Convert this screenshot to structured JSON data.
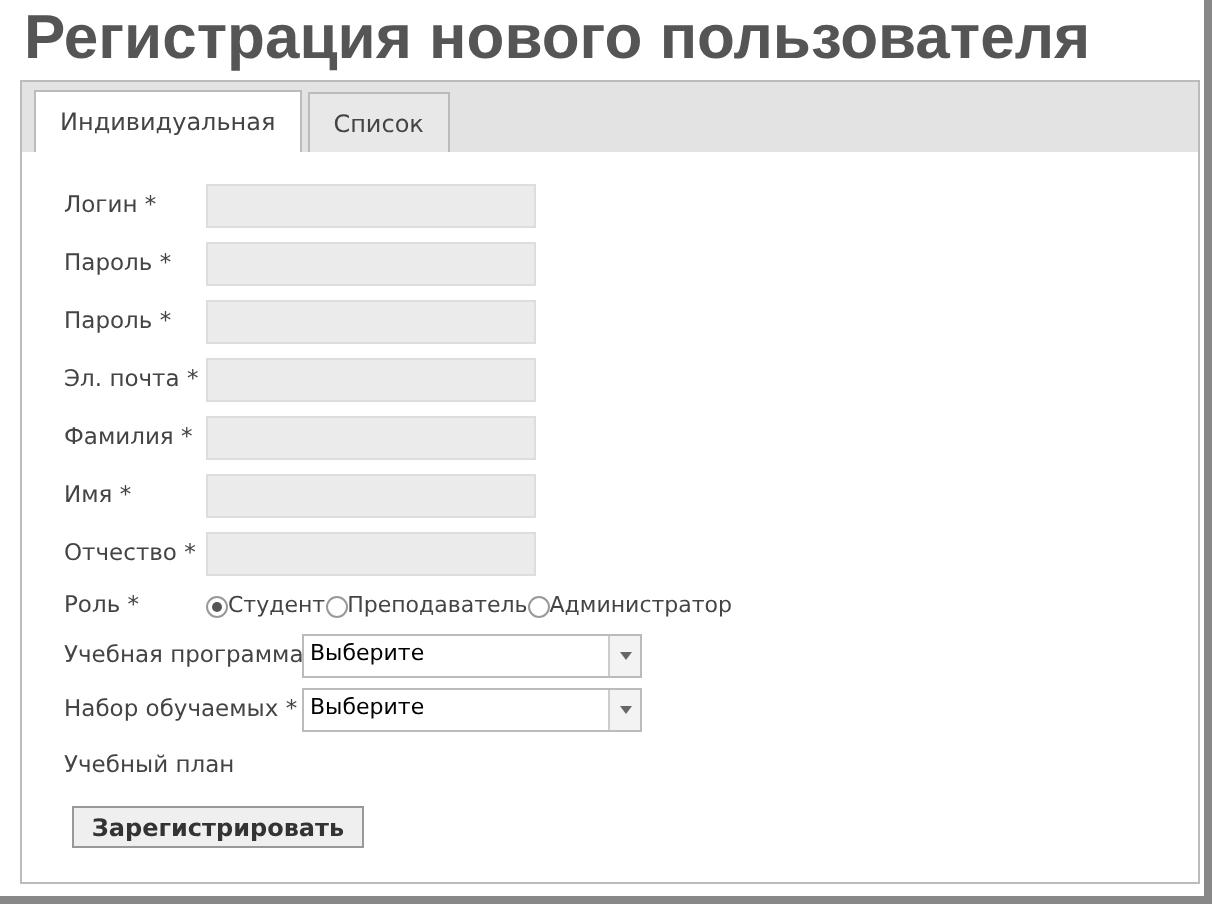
{
  "title": "Регистрация нового пользователя",
  "tabs": [
    {
      "label": "Индивидуальная",
      "selected": true
    },
    {
      "label": "Список",
      "selected": false
    }
  ],
  "fields": [
    {
      "label": "Логин *"
    },
    {
      "label": "Пароль *"
    },
    {
      "label": "Пароль *"
    },
    {
      "label": "Эл. почта *"
    },
    {
      "label": "Фамилия *"
    },
    {
      "label": "Имя *"
    },
    {
      "label": "Отчество *"
    }
  ],
  "role": {
    "label": "Роль *",
    "options": [
      {
        "label": "Студент",
        "selected": true
      },
      {
        "label": "Преподаватель",
        "selected": false
      },
      {
        "label": "Администратор",
        "selected": false
      }
    ]
  },
  "selects": [
    {
      "label": "Учебная программа",
      "value": "Выберите"
    },
    {
      "label": "Набор обучаемых *",
      "value": "Выберите"
    }
  ],
  "plan_label": "Учебный план",
  "submit": "Зарегистрировать"
}
